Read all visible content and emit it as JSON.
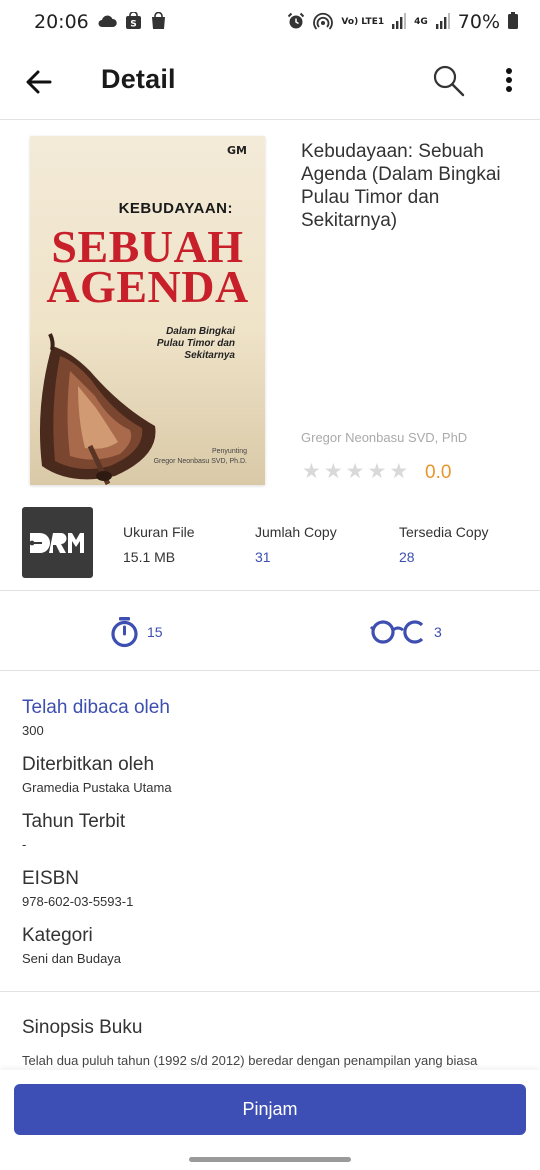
{
  "status_bar": {
    "time": "20:06",
    "network_label": "Vo) LTE1",
    "signal_label": "4G",
    "battery": "70%",
    "left_icons": [
      "cloud-icon",
      "shop-icon",
      "bag-icon"
    ],
    "right_icons": [
      "alarm-icon",
      "hotspot-icon",
      "signal-icon",
      "battery-icon"
    ]
  },
  "app_bar": {
    "title": "Detail"
  },
  "book": {
    "cover": {
      "publisher_mark": "GM",
      "pre_title": "KEBUDAYAAN:",
      "title_line1": "SEBUAH",
      "title_line2": "AGENDA",
      "subtitle_line1": "Dalam Bingkai",
      "subtitle_line2": "Pulau Timor dan",
      "subtitle_line3": "Sekitarnya",
      "editor_label": "Penyunting",
      "editor_name": "Gregor Neonbasu SVD, Ph.D."
    },
    "title": "Kebudayaan: Sebuah Agenda (Dalam Bingkai Pulau Timor dan Sekitarnya)",
    "author": "Gregor Neonbasu SVD, PhD",
    "rating": "0.0",
    "stars_filled": 0,
    "stars_total": 5
  },
  "info": {
    "drm_label": "DRM",
    "file_size_label": "Ukuran File",
    "file_size": "15.1 MB",
    "copies_label": "Jumlah Copy",
    "copies": "31",
    "available_label": "Tersedia Copy",
    "available": "28"
  },
  "stats": {
    "duration": "15",
    "readers": "3"
  },
  "details": {
    "read_by_label": "Telah dibaca oleh",
    "read_by": "300",
    "publisher_label": "Diterbitkan oleh",
    "publisher": "Gramedia Pustaka Utama",
    "year_label": "Tahun Terbit",
    "year": "-",
    "eisbn_label": "EISBN",
    "eisbn": "978-602-03-5593-1",
    "category_label": "Kategori",
    "category": "Seni dan Budaya"
  },
  "synopsis": {
    "title": "Sinopsis Buku",
    "text": "Telah dua puluh tahun (1992 s/d 2012) beredar dengan penampilan yang biasa"
  },
  "actions": {
    "borrow_label": "Pinjam"
  },
  "colors": {
    "accent": "#3d4fb5",
    "rating": "#e8962a",
    "cover_title": "#c8202b"
  }
}
